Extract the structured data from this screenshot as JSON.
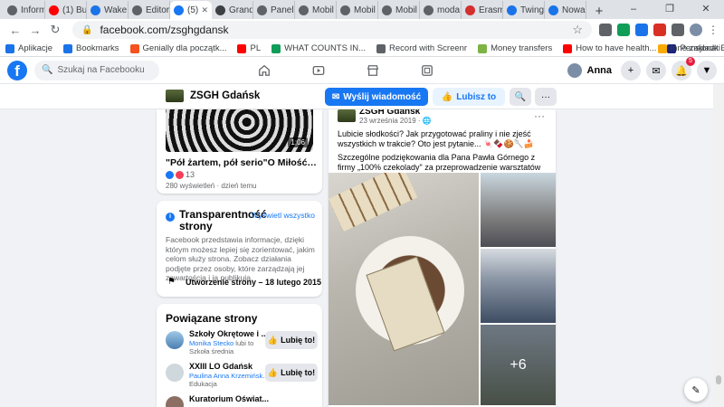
{
  "browser": {
    "tabs": [
      {
        "label": "Inform",
        "color": "#5f6368"
      },
      {
        "label": "(1) Bu",
        "color": "#ff0000"
      },
      {
        "label": "Wake",
        "color": "#1a73e8"
      },
      {
        "label": "Editor",
        "color": "#5f6368"
      },
      {
        "label": "(5)",
        "color": "#1877f2",
        "active": true
      },
      {
        "label": "Grand",
        "color": "#3c4043"
      },
      {
        "label": "Panel",
        "color": "#5f6368"
      },
      {
        "label": "Mobil",
        "color": "#5f6368"
      },
      {
        "label": "Mobil",
        "color": "#5f6368"
      },
      {
        "label": "Mobil",
        "color": "#5f6368"
      },
      {
        "label": "moda",
        "color": "#5f6368"
      },
      {
        "label": "Erasm",
        "color": "#d32f2f"
      },
      {
        "label": "Twing",
        "color": "#1a73e8"
      },
      {
        "label": "Nowa",
        "color": "#1a73e8"
      }
    ],
    "new_tab": "+",
    "url": "facebook.com/zsghgdansk",
    "bookmarks": [
      {
        "label": "Aplikacje",
        "color": "#1a73e8"
      },
      {
        "label": "Bookmarks",
        "color": "#1a73e8"
      },
      {
        "label": "Genially dla początk...",
        "color": "#f4511e"
      },
      {
        "label": "PL",
        "color": "#ff0000"
      },
      {
        "label": "WHAT COUNTS IN...",
        "color": "#0f9d58"
      },
      {
        "label": "Record with Screenr",
        "color": "#5f6368"
      },
      {
        "label": "Money transfers",
        "color": "#7cb342"
      },
      {
        "label": "How to have health...",
        "color": "#ff0000"
      },
      {
        "label": "Pensjonat B&B Gdá...",
        "color": "#1a237e"
      }
    ],
    "bookmarks_other": "Inne zakładki"
  },
  "facebook": {
    "search_placeholder": "Szukaj na Facebooku",
    "user_name": "Anna",
    "notif_count": "5"
  },
  "page_header": {
    "name": "ZSGH Gdańsk",
    "message_button": "Wyślij wiadomość",
    "like_button": "Lubisz to"
  },
  "video": {
    "duration": "1:06",
    "title": "\"Pół żartem, pół serio\"O Miłość Wprost...",
    "reaction_count": "13",
    "meta": "280 wyświetleń · dzień temu"
  },
  "transparency": {
    "title": "Transparentność strony",
    "link": "Wyświetl wszystko",
    "description": "Facebook przedstawia informacje, dzięki którym możesz lepiej się zorientować, jakim celom służy strona. Zobacz działania podjęte przez osoby, które zarządzają jej zawartością i ją publikują.",
    "created": "Utworzenie strony – 18 lutego 2015"
  },
  "related": {
    "title": "Powiązane strony",
    "like_label": "Lubię to!",
    "items": [
      {
        "name": "Szkoły Okrętowe i ...",
        "sub_link": "Monika Stecko",
        "sub_text": " lubi to",
        "category": "Szkoła średnia"
      },
      {
        "name": "XXIII LO Gdańsk",
        "sub_link": "Paulina Anna Krzemińsk...",
        "sub_text": "",
        "category": "Edukacja"
      },
      {
        "name": "Kuratorium Oświat...",
        "sub_link": "",
        "sub_text": "",
        "category": ""
      }
    ]
  },
  "post": {
    "author": "ZSGH Gdańsk",
    "date": "23 września 2019 ·",
    "line1": "Lubicie słodkości? Jak przygotować praliny i nie zjeść wszystkich w trakcie? Oto jest pytanie...",
    "line2": "Szczególne podziękowania dla Pana Pawła Górnego z firmy „100% czekolady\" za przeprowadzenie warsztatów",
    "more_photos": "+6"
  },
  "colors": {
    "fb_blue": "#1877f2",
    "fb_bg": "#f0f2f5"
  }
}
